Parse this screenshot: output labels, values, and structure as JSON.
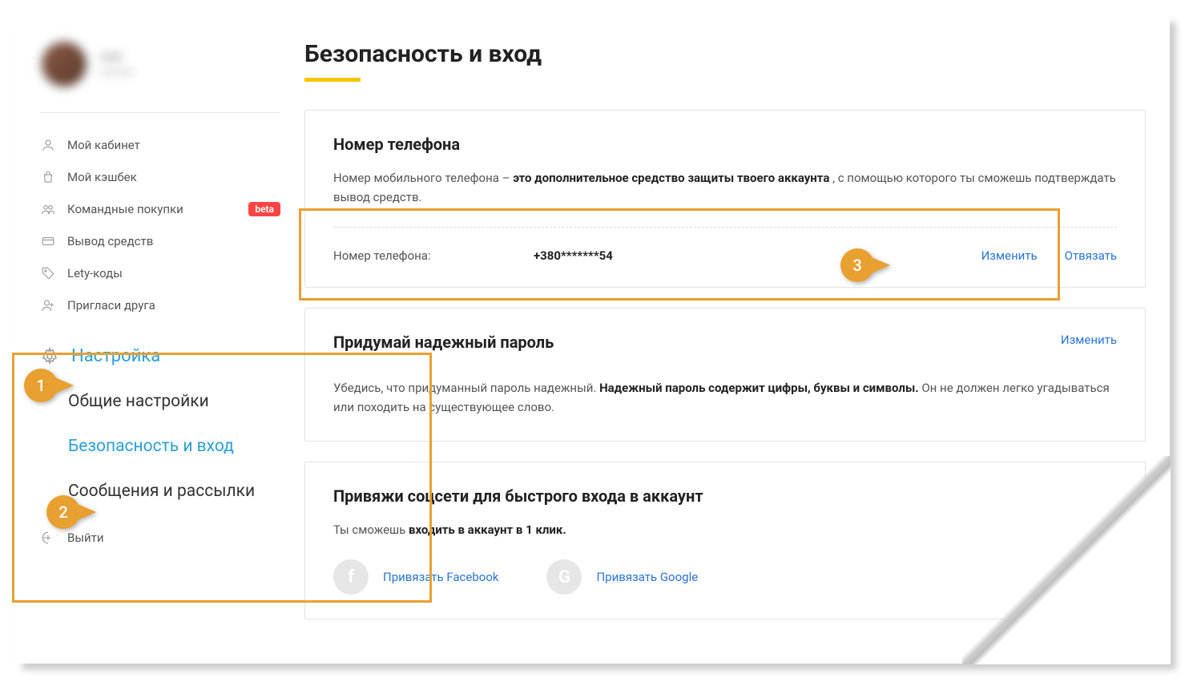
{
  "sidebar": {
    "items": {
      "cabinet": {
        "label": "Мой кабинет"
      },
      "cashback": {
        "label": "Мой кэшбек"
      },
      "team": {
        "label": "Командные покупки",
        "badge": "beta"
      },
      "withdraw": {
        "label": "Вывод средств"
      },
      "lety": {
        "label": "Lety-коды"
      },
      "invite": {
        "label": "Пригласи друга"
      },
      "logout": {
        "label": "Выйти"
      }
    },
    "settings": {
      "heading": "Настройка",
      "general": "Общие настройки",
      "security": "Безопасность и вход",
      "messages": "Сообщения и рассылки"
    }
  },
  "main": {
    "title": "Безопасность и вход",
    "phone": {
      "heading": "Номер телефона",
      "desc_pre": "Номер мобильного телефона – ",
      "desc_bold": "это дополнительное средство защиты твоего аккаунта",
      "desc_post": " , с помощью которого ты сможешь подтверждать вывод средств.",
      "row_label": "Номер телефона:",
      "value": "+380*******54",
      "change": "Изменить",
      "unlink": "Отвязать"
    },
    "password": {
      "heading": "Придумай надежный пароль",
      "change": "Изменить",
      "desc_pre": "Убедись, что придуманный пароль надежный. ",
      "desc_bold": "Надежный пароль содержит цифры, буквы и символы.",
      "desc_post": " Он не должен легко угадываться или походить на существующее слово."
    },
    "social": {
      "heading": "Привяжи соцсети для быстрого входа в аккаунт",
      "desc_pre": "Ты сможешь ",
      "desc_bold": "входить в аккаунт в 1 клик.",
      "facebook": "Привязать Facebook",
      "google": "Привязать Google"
    }
  },
  "annotations": {
    "m1": "1",
    "m2": "2",
    "m3": "3"
  }
}
